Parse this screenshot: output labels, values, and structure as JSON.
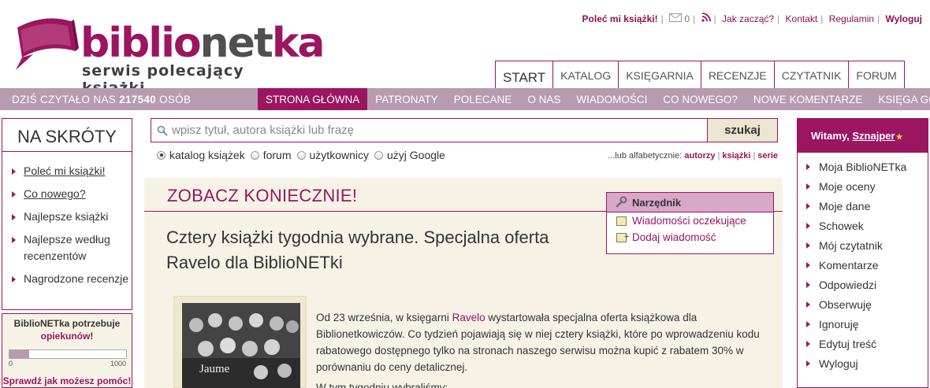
{
  "header": {
    "logo_main_a": "biblio",
    "logo_main_b": "net",
    "logo_main_c": "ka",
    "logo_sub": "serwis polecający książki",
    "top_links": {
      "recommend": "Poleć mi książki!",
      "messages_count": "0",
      "how_start": "Jak zacząć?",
      "contact": "Kontakt",
      "rules": "Regulamin",
      "logout": "Wyloguj"
    },
    "main_tabs": [
      "START",
      "KATALOG",
      "KSIĘGARNIA",
      "RECENZJE",
      "CZYTATNIK",
      "FORUM"
    ]
  },
  "navbar": {
    "count_prefix": "DZIŚ CZYTAŁO NAS",
    "count_value": "217540",
    "count_suffix": "OSÓB",
    "links": [
      "STRONA GŁÓWNA",
      "PATRONATY",
      "POLECANE",
      "O NAS",
      "WIADOMOŚCI",
      "CO NOWEGO?",
      "NOWE KOMENTARZE",
      "KSIĘGA GOŚCI"
    ]
  },
  "shortcuts": {
    "title": "NA SKRÓTY",
    "items": [
      "Poleć mi książki!",
      "Co nowego?",
      "Najlepsze książki",
      "Najlepsze według recenzentów",
      "Nagrodzone recenzje"
    ]
  },
  "support": {
    "title_a": "BiblioNETka potrzebuje",
    "title_b": "opiekunów",
    "title_c": "!",
    "progress_fraction": 0.17,
    "min_label": "0",
    "max_label": "1000",
    "link": "Sprawdź jak możesz pomóc!"
  },
  "search": {
    "placeholder": "wpisz tytuł, autora książki lub frazę",
    "button": "szukaj",
    "options": [
      "katalog książek",
      "forum",
      "użytkownicy",
      "użyj Google"
    ],
    "alpha_prefix": "...lub alfabetycznie:",
    "alpha_links": [
      "autorzy",
      "książki",
      "serie"
    ]
  },
  "main": {
    "section_title": "ZOBACZ KONIECZNIE!",
    "article_title": "Cztery książki tygodnia wybrane. Specjalna oferta Ravelo dla BiblioNETki",
    "cover_author": "Jaume",
    "body_a": "Od 23 września, w księgarni ",
    "body_link": "Ravelo",
    "body_b": " wystartowała specjalna oferta książkowa dla Biblionetkowiczów. Co tydzień pojawiają się w niej cztery książki, które po wprowadzeniu kodu rabatowego dostępnego tylko na stronach naszego serwisu można kupić z rabatem 30% w porównaniu do ceny detalicznej.",
    "body_more": "W tym tygodniu wybraliśmy:"
  },
  "tools": {
    "title": "Narzędnik",
    "items": [
      "Wiadomości oczekujące",
      "Dodaj wiadomość"
    ]
  },
  "user_menu": {
    "greeting": "Witamy,",
    "username": "Sznajper",
    "items": [
      "Moja BiblioNETka",
      "Moje oceny",
      "Moje dane",
      "Schowek",
      "Mój czytatnik",
      "Komentarze",
      "Odpowiedzi",
      "Obserwuję",
      "Ignoruję",
      "Edytuj treść",
      "Wyloguj"
    ]
  },
  "colors": {
    "brand": "#9b1560",
    "navbar": "#b69bb1",
    "content_bg": "#f6f3e6"
  }
}
